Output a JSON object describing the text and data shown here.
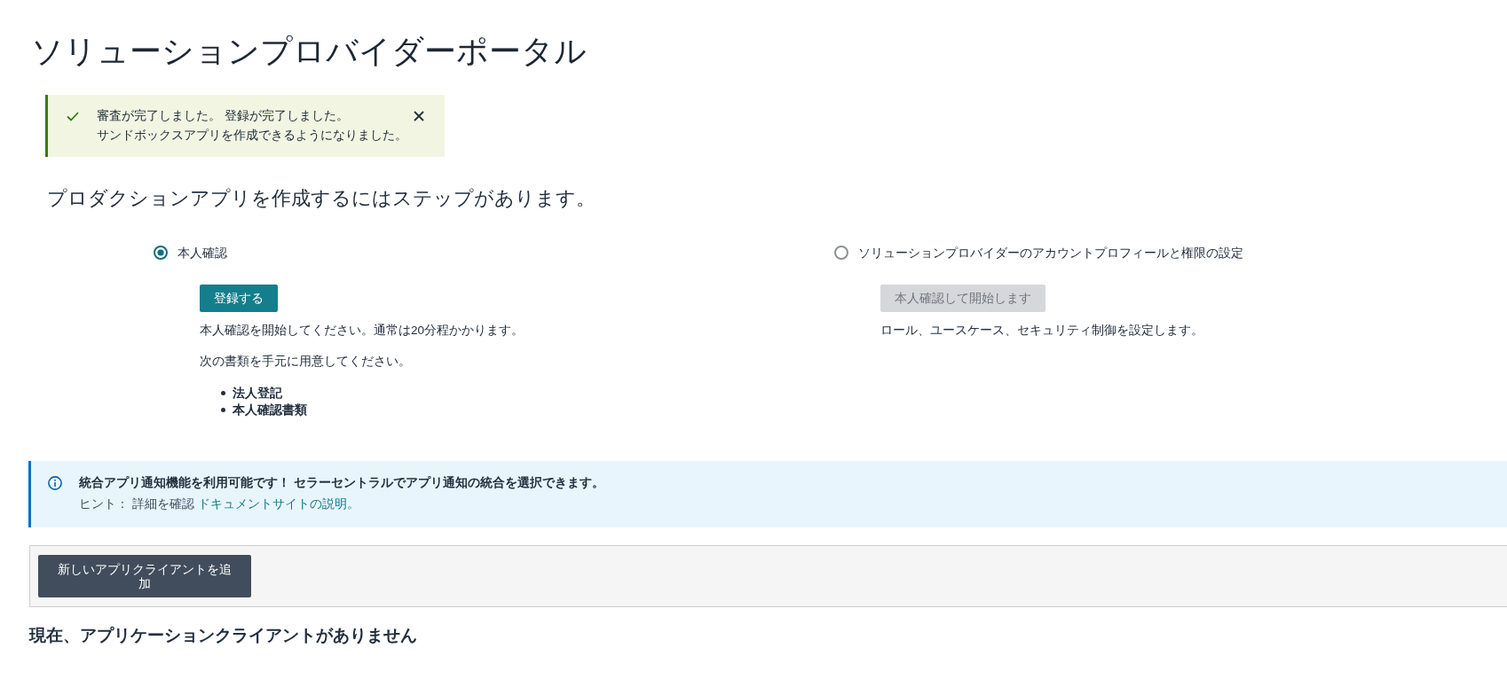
{
  "page": {
    "title": "ソリューションプロバイダーポータル"
  },
  "success_alert": {
    "lines": [
      "審査が完了しました。 登録が完了しました。",
      "サンドボックスアプリを作成できるようになりました。"
    ]
  },
  "intro": "プロダクションアプリを作成するにはステップがあります。",
  "steps": [
    {
      "label": "本人確認",
      "selected": true,
      "button": {
        "label": "登録する",
        "disabled": false
      },
      "description": "本人確認を開始してください。通常は20分程かかります。",
      "documents_prompt": "次の書類を手元に用意してください。",
      "documents": [
        "法人登記",
        "本人確認書類"
      ]
    },
    {
      "label": "ソリューションプロバイダーのアカウントプロフィールと権限の設定",
      "selected": false,
      "button": {
        "label": "本人確認して開始します",
        "disabled": true
      },
      "description": "ロール、ユースケース、セキュリティ制御を設定します。"
    }
  ],
  "info_alert": {
    "title": "統合アプリ通知機能を利用可能です！ セラーセントラルでアプリ通知の統合を選択できます。",
    "hint": "ヒント： 詳細を確認",
    "link": "ドキュメントサイトの説明。"
  },
  "toolbar": {
    "button": "新しいアプリクライアントを追加"
  },
  "empty_state": "現在、アプリケーションクライアントがありません"
}
